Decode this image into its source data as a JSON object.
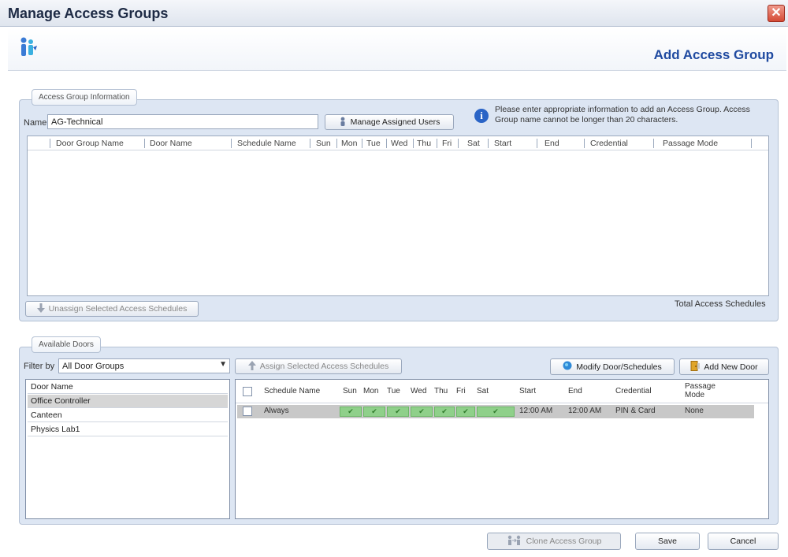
{
  "window": {
    "title": "Manage Access Groups",
    "close_glyph": "✕"
  },
  "header": {
    "page_title": "Add Access Group",
    "logo_icon": "access-people-icon"
  },
  "group_info": {
    "tab_label": "Access Group Information",
    "name_label": "Name",
    "name_value": "AG-Technical",
    "manage_users_label": "Manage Assigned Users",
    "info_text": "Please enter appropriate information to add an Access Group. Access Group name cannot be longer than 20 characters.",
    "columns": [
      "Door Group Name",
      "Door Name",
      "Schedule Name",
      "Sun",
      "Mon",
      "Tue",
      "Wed",
      "Thu",
      "Fri",
      "Sat",
      "Start",
      "End",
      "Credential",
      "Passage Mode"
    ],
    "unassign_label": "Unassign Selected Access Schedules",
    "total_label": "Total Access Schedules"
  },
  "available_doors": {
    "tab_label": "Available Doors",
    "filter_label": "Filter by",
    "filter_value": "All Door Groups",
    "assign_label": "Assign Selected Access Schedules",
    "modify_label": "Modify Door/Schedules",
    "add_door_label": "Add New Door",
    "door_header": "Door Name",
    "doors": [
      "Office Controller",
      "Canteen",
      "Physics Lab1"
    ],
    "schedule_columns": [
      "Schedule Name",
      "Sun",
      "Mon",
      "Tue",
      "Wed",
      "Thu",
      "Fri",
      "Sat",
      "Start",
      "End",
      "Credential",
      "Passage Mode"
    ],
    "schedule_rows": [
      {
        "name": "Always",
        "start": "12:00 AM",
        "end": "12:00 AM",
        "credential": "PIN & Card",
        "passage": "None"
      }
    ]
  },
  "footer": {
    "clone_label": "Clone Access Group",
    "save_label": "Save",
    "cancel_label": "Cancel"
  },
  "colors": {
    "accent": "#1f4aa0",
    "panel_bg": "#dde6f3",
    "check_green": "#8fd08a"
  }
}
